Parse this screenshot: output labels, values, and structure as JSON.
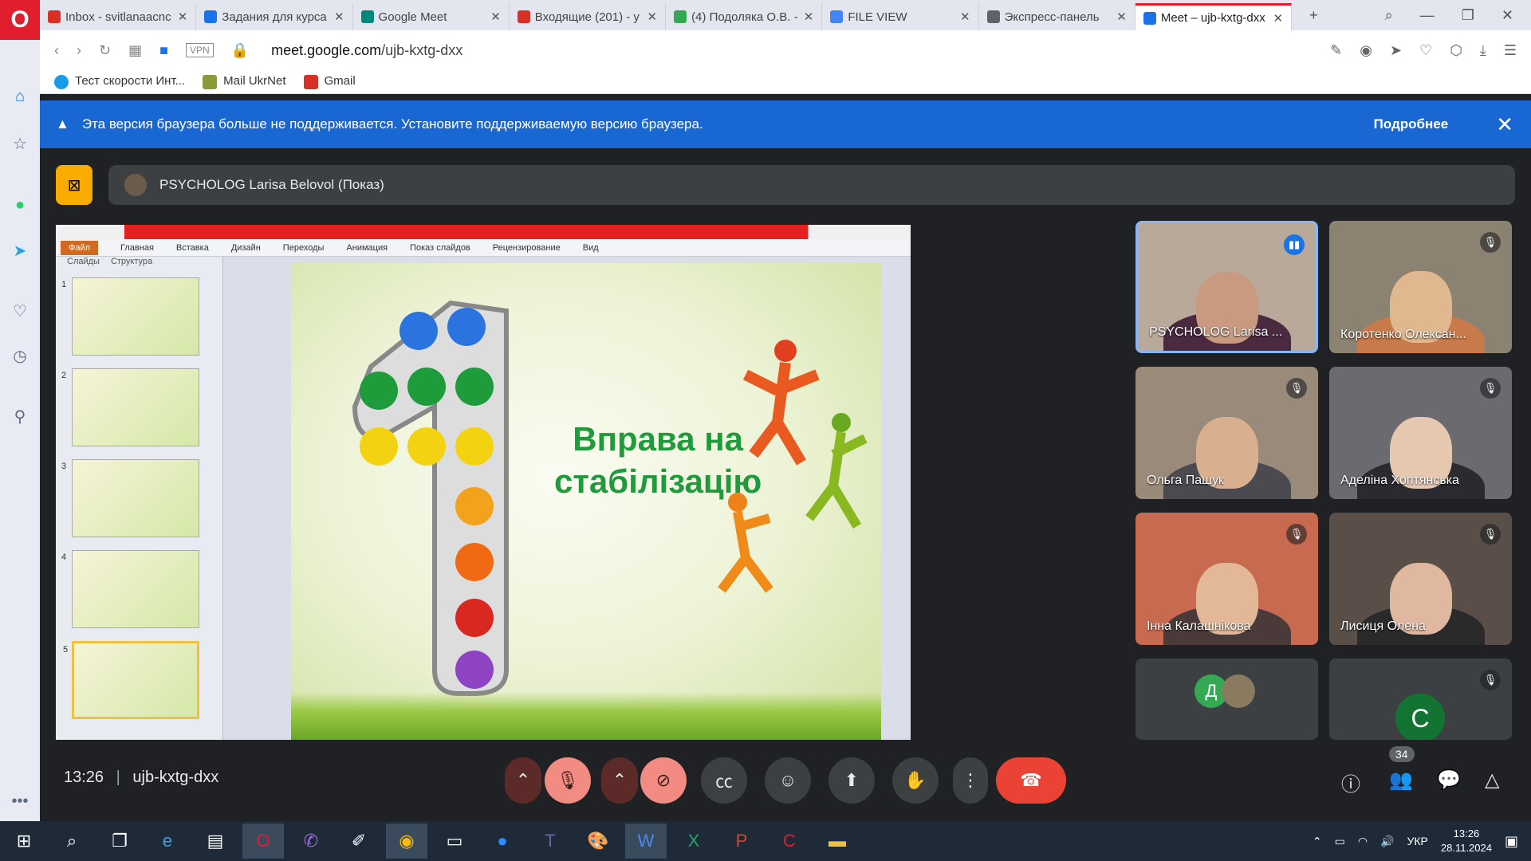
{
  "browser": {
    "tabs": [
      {
        "title": "Inbox - svitlanaacnc",
        "color": "#d93025",
        "active": false
      },
      {
        "title": "Задания для курса",
        "color": "#1a73e8",
        "active": false
      },
      {
        "title": "Google Meet",
        "color": "#00897b",
        "active": false
      },
      {
        "title": "Входящие (201) - y",
        "color": "#d93025",
        "active": false
      },
      {
        "title": "(4) Подоляка О.В. -",
        "color": "#34a853",
        "active": false
      },
      {
        "title": "FILE VIEW",
        "color": "#4285f4",
        "active": false
      },
      {
        "title": "Экспресс-панель",
        "color": "#5f6368",
        "active": false
      },
      {
        "title": "Meet – ujb-kxtg-dxx",
        "color": "#1a73e8",
        "active": true
      }
    ],
    "url_host": "meet.google.com",
    "url_path": "/ujb-kxtg-dxx",
    "vpn": "VPN",
    "bookmarks": [
      "Тест скорости Инт...",
      "Mail UkrNet",
      "Gmail"
    ]
  },
  "banner": {
    "text": "Эта версия браузера больше не поддерживается. Установите поддерживаемую версию браузера.",
    "more": "Подробнее"
  },
  "presentation": {
    "presenter": "PSYCHOLOG Larisa Belovol (Показ)",
    "ribbon": [
      "Файл",
      "Главная",
      "Вставка",
      "Дизайн",
      "Переходы",
      "Анимация",
      "Показ слайдов",
      "Рецензирование",
      "Вид"
    ],
    "panel_tabs": [
      "Слайды",
      "Структура"
    ],
    "thumb_numbers": [
      "1",
      "2",
      "3",
      "4",
      "5"
    ],
    "slide_title_line1": "Вправа на",
    "slide_title_line2": "стабілізацію"
  },
  "participants": [
    {
      "name": "PSYCHOLOG Larisa ...",
      "speaking": true
    },
    {
      "name": "Коротенко Олексан...",
      "speaking": false
    },
    {
      "name": "Ольга Пашук",
      "speaking": false
    },
    {
      "name": "Аделіна Хоптянська",
      "speaking": false
    },
    {
      "name": "Інна Калашнікова",
      "speaking": false
    },
    {
      "name": "Лисиця Олена",
      "speaking": false
    }
  ],
  "extra_tiles": {
    "initial_left": "Д",
    "initial_right": "С"
  },
  "meeting": {
    "time": "13:26",
    "code": "ujb-kxtg-dxx",
    "people_count": "34"
  },
  "taskbar": {
    "lang": "УКР",
    "time": "13:26",
    "date": "28.11.2024"
  }
}
